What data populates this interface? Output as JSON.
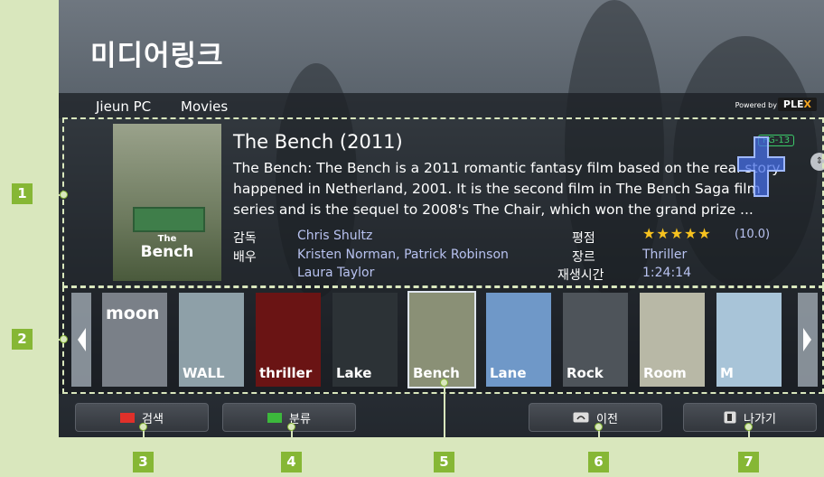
{
  "app_title": "미디어링크",
  "breadcrumb": [
    "Jieun PC",
    "Movies"
  ],
  "powered_by": "Powered by",
  "brand": {
    "name_main": "PLE",
    "name_x": "X"
  },
  "movie": {
    "title": "The Bench (2011)",
    "description": "The Bench: The Bench is a 2011 romantic fantasy film based on the real story happened in Netherland, 2001. It is the second film in The Bench Saga film series and is the sequel to 2008's The Chair, which won the grand prize ...",
    "rating_badge": "PG-13",
    "poster": {
      "line1": "The",
      "line2": "Bench"
    },
    "director_label": "감독",
    "director": "Chris Shultz",
    "cast_label": "배우",
    "cast_line1": "Kristen Norman, Patrick Robinson",
    "cast_line2": "Laura Taylor",
    "rating_label": "평점",
    "stars": "★★★★★",
    "rating_value": "(10.0)",
    "genre_label": "장르",
    "genre": "Thriller",
    "runtime_label": "재생시간",
    "runtime": "1:24:14"
  },
  "thumbnails": [
    {
      "title": "moon",
      "color": "#7a8088"
    },
    {
      "title": "WALL",
      "color": "#8ea0a8"
    },
    {
      "title": "thriller",
      "color": "#6a1414"
    },
    {
      "title": "Lake",
      "color": "#2c3236"
    },
    {
      "title": "Bench",
      "color": "#8a9076"
    },
    {
      "title": "Lane",
      "color": "#6f98c8"
    },
    {
      "title": "Rock",
      "color": "#4e545a"
    },
    {
      "title": "Room",
      "color": "#b8b8a6"
    },
    {
      "title": "M",
      "color": "#a8c4d8"
    }
  ],
  "buttons": {
    "search": {
      "label": "검색",
      "color": "#e0302a"
    },
    "sort": {
      "label": "분류",
      "color": "#3cb83c"
    },
    "back": {
      "label": "이전"
    },
    "exit": {
      "label": "나가기"
    }
  },
  "callouts": [
    "1",
    "2",
    "3",
    "4",
    "5",
    "6",
    "7"
  ]
}
